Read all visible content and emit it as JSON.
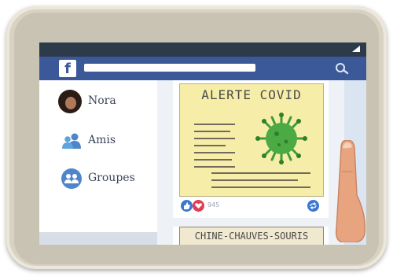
{
  "sidebar": {
    "items": [
      {
        "label": "Nora",
        "icon": "avatar"
      },
      {
        "label": "Amis",
        "icon": "friends-icon"
      },
      {
        "label": "Groupes",
        "icon": "groups-icon"
      }
    ]
  },
  "topbar": {
    "logo_letter": "f"
  },
  "feed": {
    "posts": [
      {
        "title": "ALERTE COVID",
        "reaction_count": "945"
      },
      {
        "title": "CHINE-CHAUVES-SOURIS"
      }
    ]
  },
  "colors": {
    "brand": "#3b5998",
    "post_background": "#f6eea8",
    "virus": "#3f9b3a"
  }
}
